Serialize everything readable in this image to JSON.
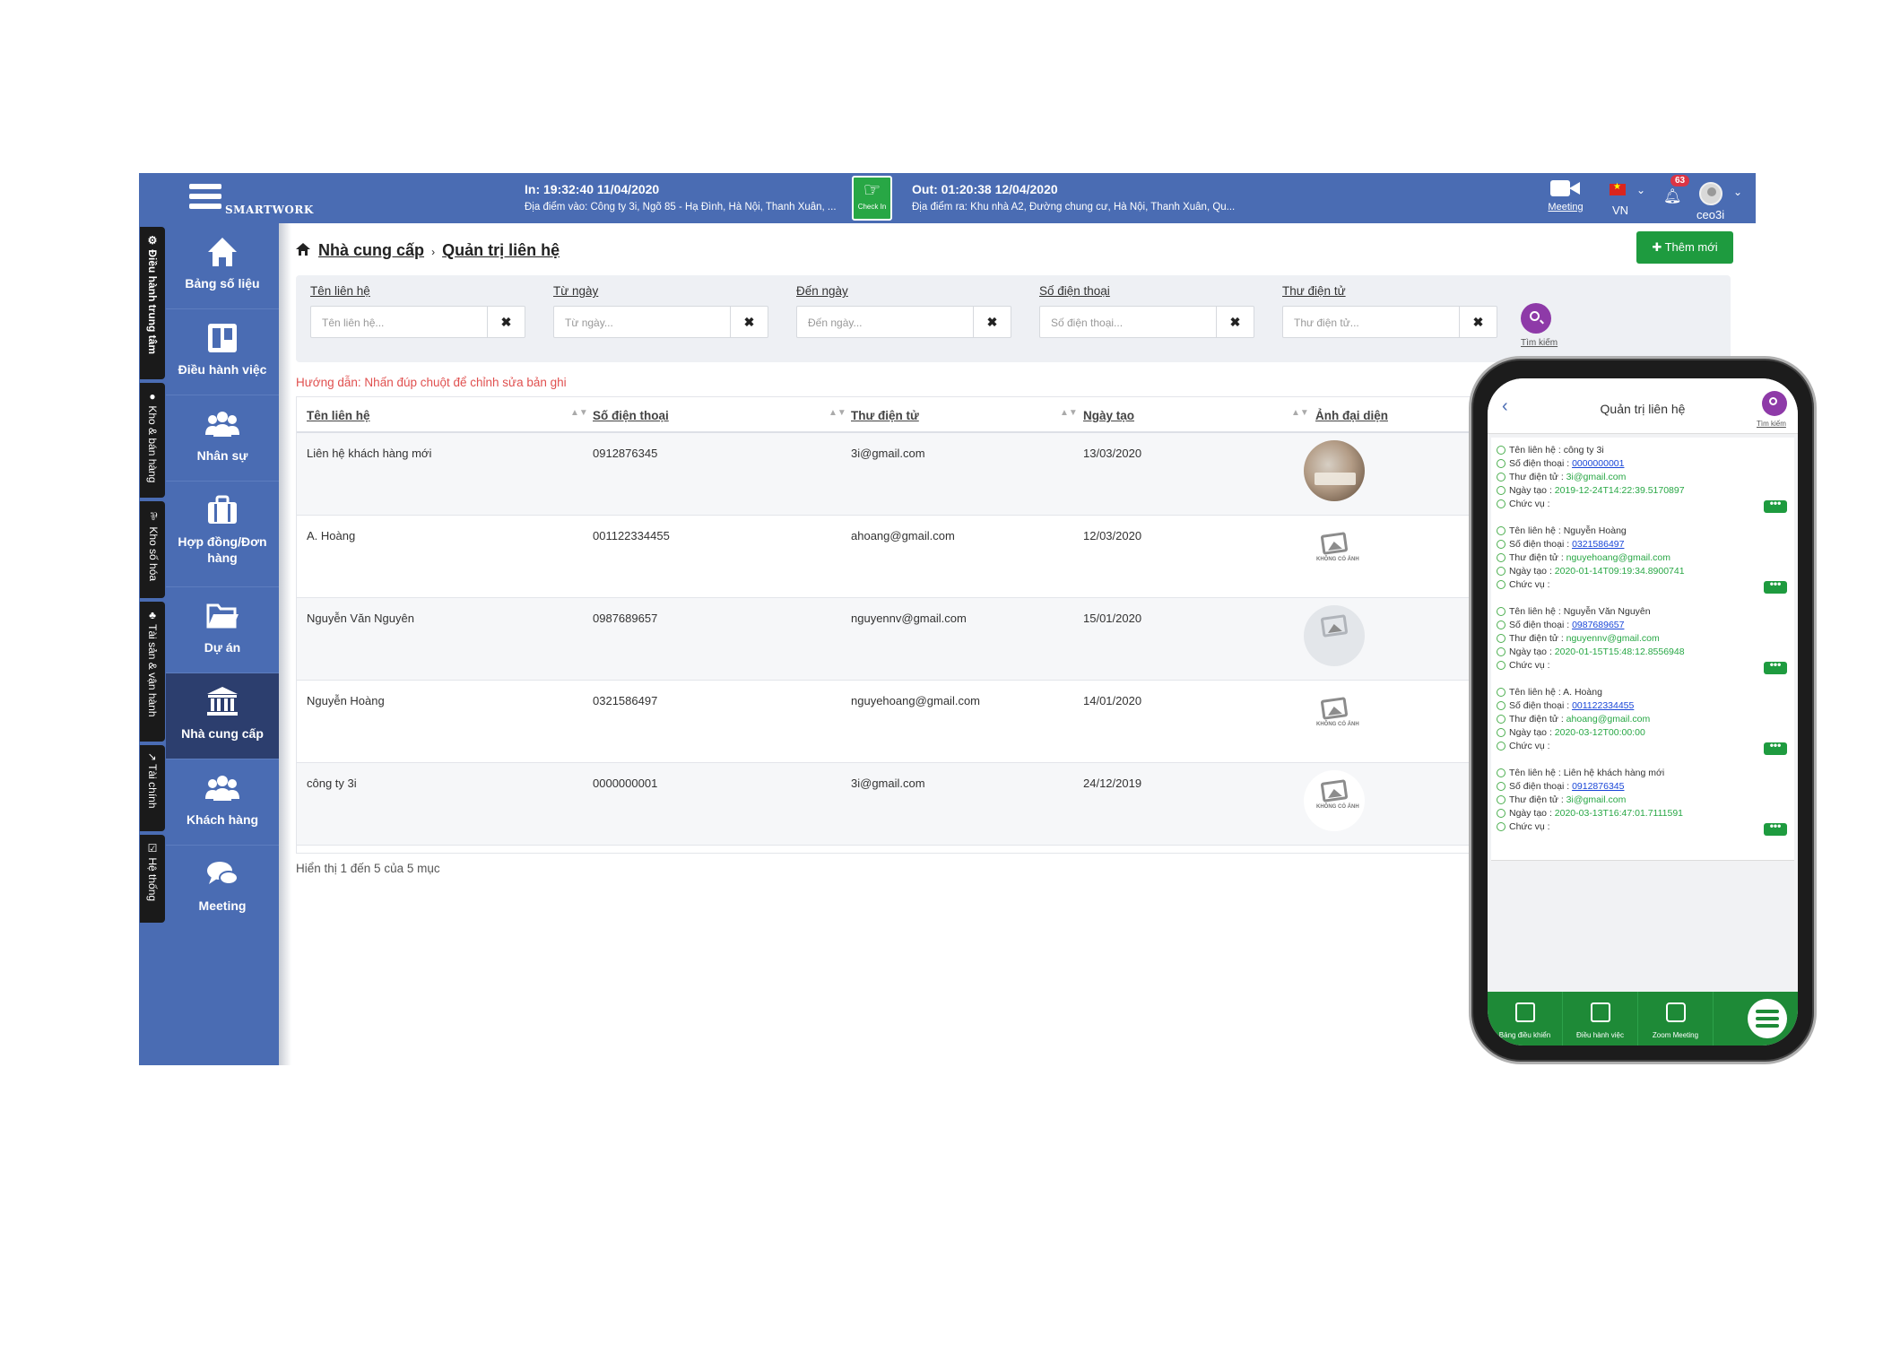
{
  "topbar": {
    "logo_text": "SMARTWORK",
    "check_in_time": "In: 19:32:40 11/04/2020",
    "check_in_address": "Địa điểm vào: Công ty 3i, Ngõ 85 - Hạ Đình, Hà Nội, Thanh Xuân, ...",
    "check_in_button": "Check In",
    "check_out_time": "Out: 01:20:38 12/04/2020",
    "check_out_address": "Địa điểm ra: Khu nhà A2, Đường chung cư, Hà Nội, Thanh Xuân, Qu...",
    "meeting_label": "Meeting",
    "language_code": "VN",
    "notification_count": "63",
    "username": "ceo3i"
  },
  "vertical_tabs": [
    {
      "label": "⚙ Điều hành trung tâm"
    },
    {
      "label": "● Kho & bán hàng"
    },
    {
      "label": "⅌ Kho số hóa"
    },
    {
      "label": "♣ Tài sản & vận hành"
    },
    {
      "label": "↗ Tài chính"
    },
    {
      "label": "☑ Hệ thống"
    }
  ],
  "sidenav": [
    {
      "label": "Bảng số liệu",
      "icon": "home-icon"
    },
    {
      "label": "Điều hành việc",
      "icon": "board-icon"
    },
    {
      "label": "Nhân sự",
      "icon": "users-icon"
    },
    {
      "label": "Hợp đồng/Đơn hàng",
      "icon": "briefcase-icon"
    },
    {
      "label": "Dự án",
      "icon": "folder-icon"
    },
    {
      "label": "Nhà cung cấp",
      "icon": "bank-icon"
    },
    {
      "label": "Khách hàng",
      "icon": "users-icon"
    },
    {
      "label": "Meeting",
      "icon": "chat-icon"
    }
  ],
  "breadcrumb": {
    "parent": "Nhà cung cấp",
    "current": "Quản trị liên hệ"
  },
  "add_button": "Thêm mới",
  "filters": [
    {
      "label": "Tên liên hệ",
      "placeholder": "Tên liên hệ..."
    },
    {
      "label": "Từ ngày",
      "placeholder": "Từ ngày..."
    },
    {
      "label": "Đến ngày",
      "placeholder": "Đến ngày..."
    },
    {
      "label": "Số điện thoại",
      "placeholder": "Số điện thoại..."
    },
    {
      "label": "Thư điện tử",
      "placeholder": "Thư điện tử..."
    }
  ],
  "search_label": "Tìm kiếm",
  "hint": "Hướng dẫn: Nhấn đúp chuột để chỉnh sửa bản ghi",
  "table": {
    "columns": [
      "Tên liên hệ",
      "Số điện thoại",
      "Thư điện tử",
      "Ngày tạo",
      "Ảnh đại diện"
    ],
    "rows": [
      {
        "name": "Liên hệ khách hàng mới",
        "phone": "0912876345",
        "email": "3i@gmail.com",
        "date": "13/03/2020",
        "photo": "real"
      },
      {
        "name": "A. Hoàng",
        "phone": "001122334455",
        "email": "ahoang@gmail.com",
        "date": "12/03/2020",
        "photo": "none"
      },
      {
        "name": "Nguyễn Văn Nguyên",
        "phone": "0987689657",
        "email": "nguyennv@gmail.com",
        "date": "15/01/2020",
        "photo": "grey"
      },
      {
        "name": "Nguyễn Hoàng",
        "phone": "0321586497",
        "email": "nguyehoang@gmail.com",
        "date": "14/01/2020",
        "photo": "none"
      },
      {
        "name": "công ty 3i",
        "phone": "0000000001",
        "email": "3i@gmail.com",
        "date": "24/12/2019",
        "photo": "none"
      }
    ],
    "no_image_caption": "KHÔNG CÓ ẢNH"
  },
  "table_info": "Hiển thị 1 đến 5 của 5 mục",
  "mobile": {
    "title": "Quản trị liên hệ",
    "search_label": "Tìm kiếm",
    "field_labels": {
      "name": "Tên liên hệ : ",
      "phone": "Số điện thoại : ",
      "email": "Thư điện tử : ",
      "created": "Ngày tạo : ",
      "position": "Chức vụ :"
    },
    "cards": [
      {
        "name": "công ty 3i",
        "phone": "0000000001",
        "email": "3i@gmail.com",
        "created": "2019-12-24T14:22:39.5170897"
      },
      {
        "name": "Nguyễn Hoàng",
        "phone": "0321586497",
        "email": "nguyehoang@gmail.com",
        "created": "2020-01-14T09:19:34.8900741"
      },
      {
        "name": "Nguyễn Văn Nguyên",
        "phone": "0987689657",
        "email": "nguyennv@gmail.com",
        "created": "2020-01-15T15:48:12.8556948"
      },
      {
        "name": "A. Hoàng",
        "phone": "001122334455",
        "email": "ahoang@gmail.com",
        "created": "2020-03-12T00:00:00"
      },
      {
        "name": "Liên hệ khách hàng mới",
        "phone": "0912876345",
        "email": "3i@gmail.com",
        "created": "2020-03-13T16:47:01.7111591"
      }
    ],
    "more_label": "•••",
    "bottom_tabs": [
      {
        "label": "Bảng điều khiển"
      },
      {
        "label": "Điều hành việc"
      },
      {
        "label": "Zoom Meeting"
      }
    ]
  }
}
